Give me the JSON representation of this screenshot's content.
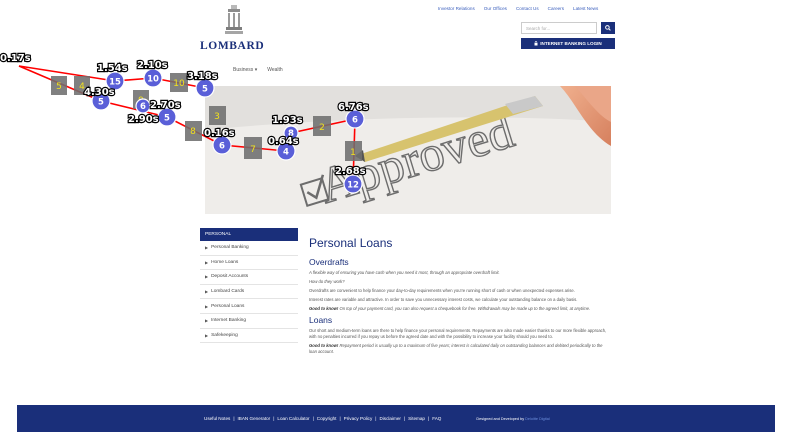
{
  "top_links": [
    "Investor Relations",
    "Our Offices",
    "Contact Us",
    "Careers",
    "Latest News"
  ],
  "logo": {
    "text": "LOMBARD"
  },
  "search": {
    "placeholder": "Search for..."
  },
  "ib_login_label": "INTERNET BANKING LOGIN",
  "nav": {
    "business": "Business",
    "wealth": "Wealth"
  },
  "hero_word": "Approved",
  "sidebar": {
    "header": "PERSONAL",
    "items": [
      "Personal Banking",
      "Home Loans",
      "Deposit Accounts",
      "Lombard Cards",
      "Personal Loans",
      "Internet Banking",
      "Safekeeping"
    ]
  },
  "content": {
    "title": "Personal Loans",
    "overdrafts": {
      "heading": "Overdrafts",
      "intro": "A flexible way of ensuring you have cash when you need it most, through an appropriate overdraft limit.",
      "how": "How do they work?",
      "p1": "Overdrafts are convenient to help finance your day-to-day requirements when you’re running short of cash or when unexpected expenses arise.",
      "p2": "Interest rates are variable and attractive. In order to save you unnecessary interest costs, we calculate your outstanding balance on a daily basis.",
      "good_label": "Good to know!",
      "good_text": "On top of your payment card, you can also request a chequebook for free. Withdrawals may be made up to the agreed limit, at anytime."
    },
    "loans": {
      "heading": "Loans",
      "p1": "Our short and medium-term loans are there to help finance your personal requirements. Repayments are also made easier thanks to our more flexible approach, with no penalties incurred if you repay us before the agreed date and with the possibility to increase your facility should you need to.",
      "good_label": "Good to know!",
      "good_text": "Repayment period is usually up to a maximum of five years; interest is calculated daily on outstanding balances and debited periodically to the loan account."
    }
  },
  "footer": {
    "links": [
      "Useful Notes",
      "IBAN Generator",
      "Loan Calculator",
      "Copyright",
      "Privacy Policy",
      "Disclaimer",
      "Sitemap",
      "FAQ"
    ],
    "separator": "|",
    "credit_prefix": "Designed and Developed by",
    "credit_brand": "Deloitte Digital"
  },
  "overlay": {
    "time_labels": [
      "0.17s",
      "1.54s",
      "2.10s",
      "3.18s",
      "4.30s",
      "2.90s",
      "2.70s",
      "0.16s",
      "1.93s",
      "0.64s",
      "6.76s",
      "2.68s"
    ],
    "number_boxes": [
      "5",
      "4",
      "10",
      "9",
      "3",
      "8",
      "7",
      "2",
      "1"
    ],
    "circles": [
      "15",
      "10",
      "5",
      "5",
      "6",
      "5",
      "6",
      "4",
      "8",
      "6",
      "12"
    ]
  },
  "colors": {
    "brand": "#1a2f7a",
    "link": "#3b5fbd",
    "overlay_circle": "#5a5fd8",
    "overlay_line": "#ff0000"
  }
}
